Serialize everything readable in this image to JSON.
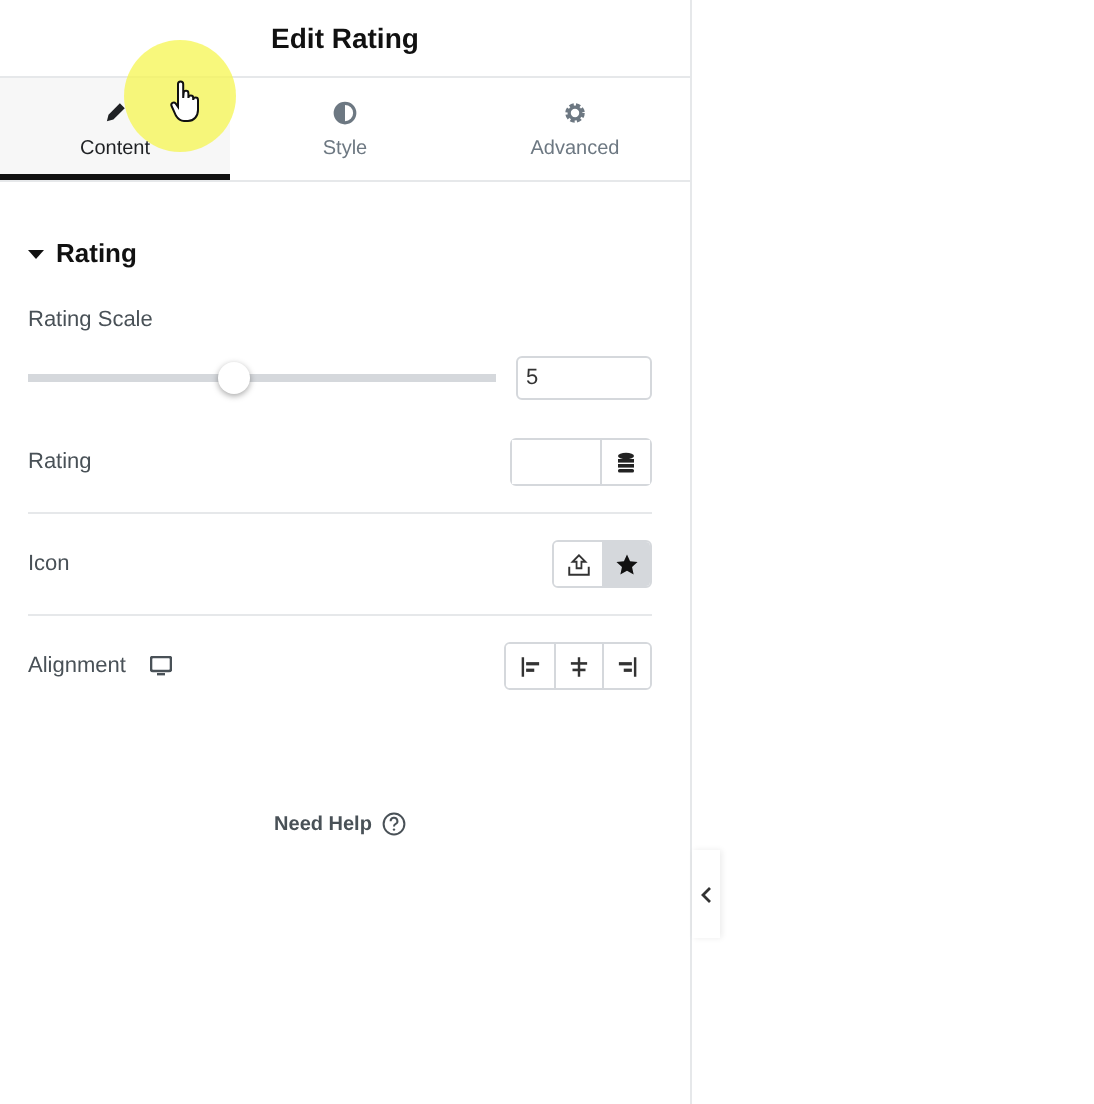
{
  "panel": {
    "title": "Edit Rating"
  },
  "tabs": [
    {
      "label": "Content",
      "selected": true
    },
    {
      "label": "Style",
      "selected": false
    },
    {
      "label": "Advanced",
      "selected": false
    }
  ],
  "section": {
    "title": "Rating",
    "expanded": true
  },
  "controls": [
    {
      "kind": "slider",
      "label": "Rating Scale",
      "level": 0.44,
      "value": "5"
    },
    {
      "kind": "dynamic",
      "label": "Rating"
    },
    {
      "kind": "icon-choice",
      "label": "Icon",
      "options": [
        {
          "selected": false
        },
        {
          "selected": true
        }
      ]
    },
    {
      "kind": "alignment",
      "label": "Alignment",
      "options": [
        {
          "selected": false
        },
        {
          "selected": false
        },
        {
          "selected": false
        }
      ]
    }
  ],
  "help": {
    "label": "Need Help"
  }
}
